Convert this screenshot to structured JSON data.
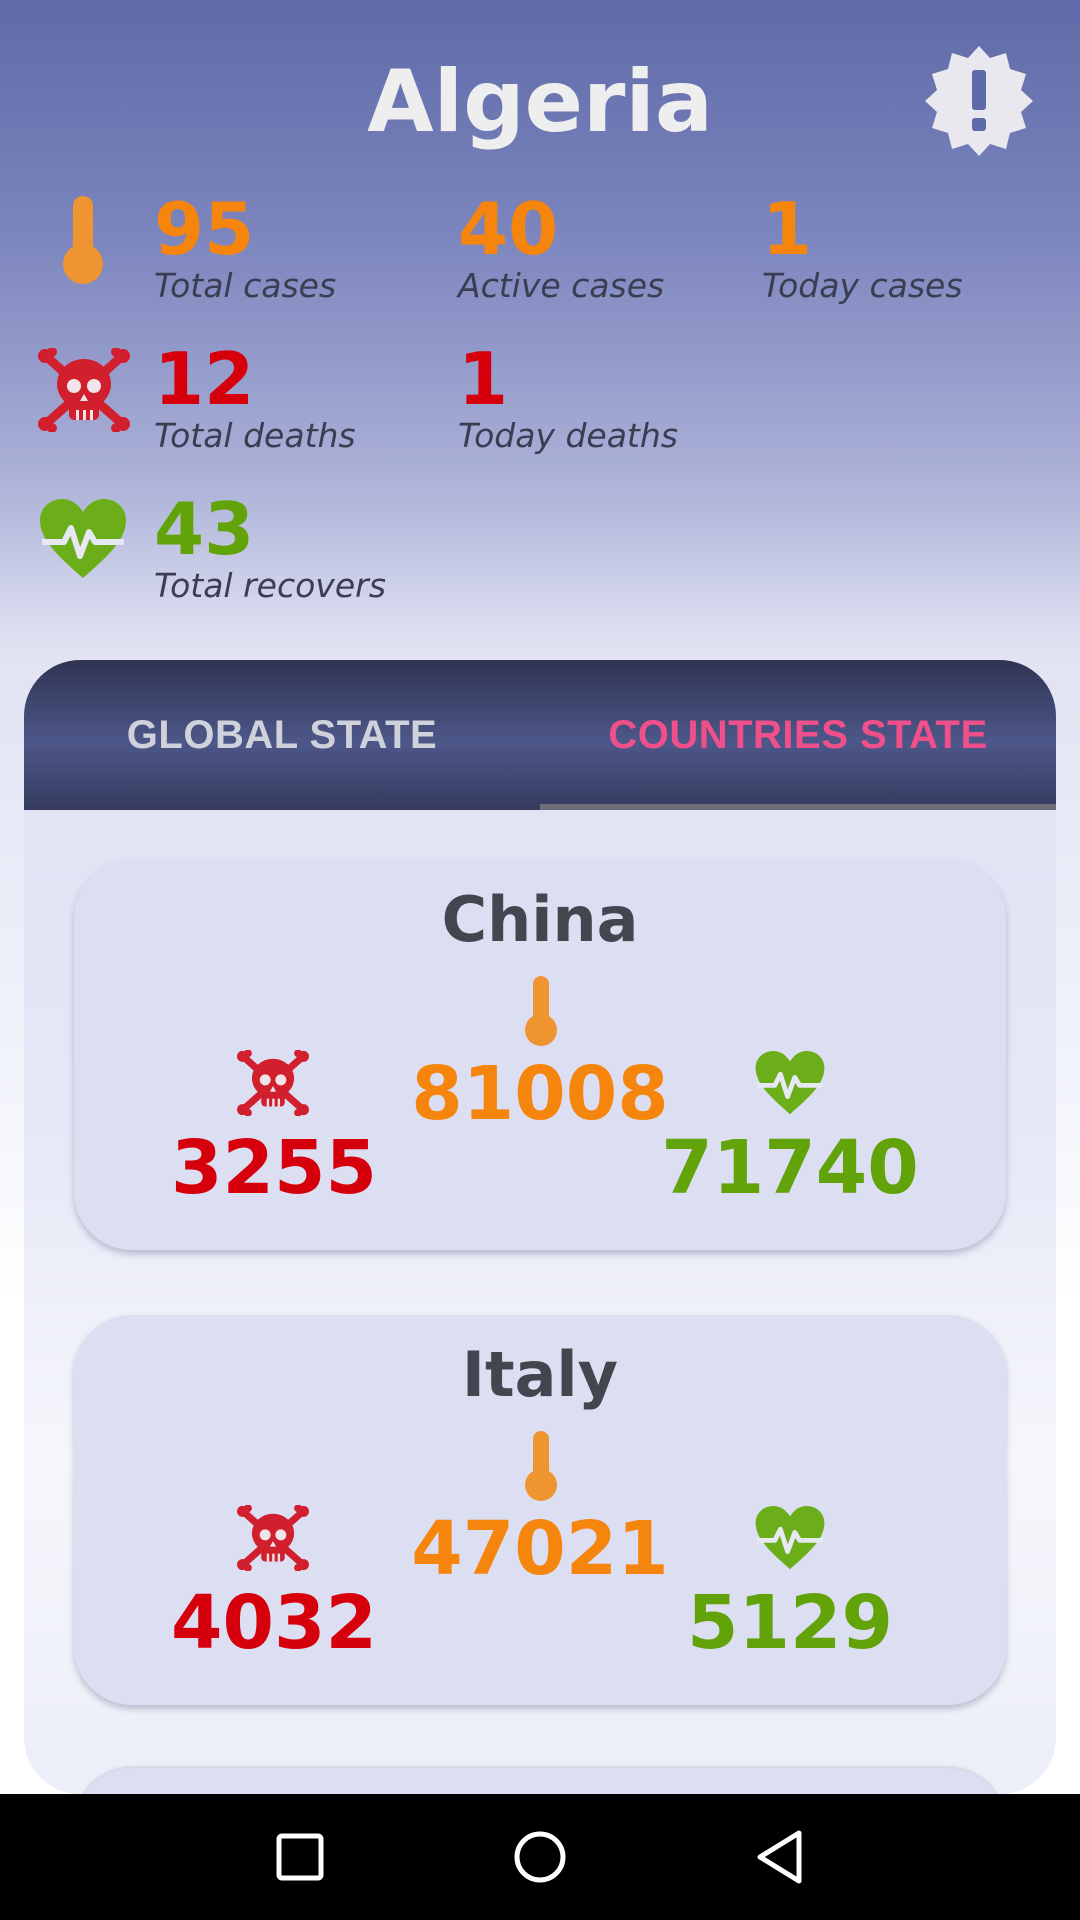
{
  "header": {
    "country": "Algeria",
    "alert_icon": "alert-badge-icon"
  },
  "stats": {
    "total_cases": {
      "value": "95",
      "label": "Total cases"
    },
    "active_cases": {
      "value": "40",
      "label": "Active cases"
    },
    "today_cases": {
      "value": "1",
      "label": "Today cases"
    },
    "total_deaths": {
      "value": "12",
      "label": "Total deaths"
    },
    "today_deaths": {
      "value": "1",
      "label": "Today deaths"
    },
    "total_recovers": {
      "value": "43",
      "label": "Total recovers"
    }
  },
  "tabs": {
    "global": "GLOBAL STATE",
    "countries": "COUNTRIES STATE",
    "active": "countries"
  },
  "countries": [
    {
      "name": "China",
      "cases": "81008",
      "deaths": "3255",
      "recovered": "71740"
    },
    {
      "name": "Italy",
      "cases": "47021",
      "deaths": "4032",
      "recovered": "5129"
    }
  ],
  "colors": {
    "cases": "#f5850c",
    "deaths": "#d6000c",
    "recovered": "#62a30a",
    "active_tab": "#f0508a"
  },
  "icons": {
    "cases": "thermometer-icon",
    "deaths": "skull-crossbones-icon",
    "recovered": "heartbeat-icon"
  },
  "navbar": {
    "buttons": [
      "recent-apps",
      "home",
      "back"
    ]
  }
}
